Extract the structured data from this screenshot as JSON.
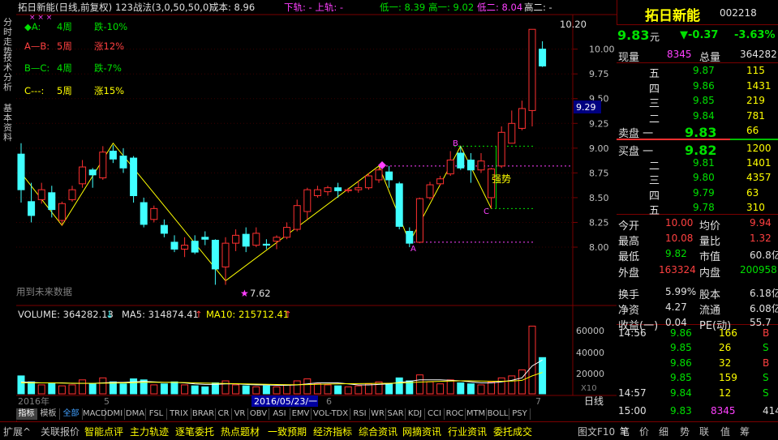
{
  "chart_header": {
    "title": "拓日新能(日线,前复权)",
    "strategy": "123战法(3,0,50,50,0)",
    "cost_label": "成本: 8.96",
    "rail_label": "下轨: - 上轨: -",
    "low1": "低一: 8.39",
    "high1": "高一: 9.02",
    "low2": "低二: 8.04",
    "high2": "高二: -"
  },
  "legend": [
    {
      "label": "◆A:",
      "weeks": "4周",
      "change": "跌-10%"
    },
    {
      "label": "A—B:",
      "weeks": "5周",
      "change": "涨12%"
    },
    {
      "label": "B—C:",
      "weeks": "4周",
      "change": "跌-7%"
    },
    {
      "label": "C---:",
      "weeks": "5周",
      "change": "涨15%"
    }
  ],
  "annotations": {
    "high_value": "10.20",
    "low_value": "7.62",
    "strong": "强势",
    "future_note": "用到未来数据",
    "point_b": "B",
    "point_c": "C",
    "point_a": "A"
  },
  "price_axis": [
    "10.00",
    "9.75",
    "9.50",
    "9.25",
    "9.00",
    "8.75",
    "8.50",
    "8.25",
    "8.00"
  ],
  "price_marker": "9.29",
  "volume_header": {
    "volume": "VOLUME: 364282.13",
    "ma5": "MA5: 314874.41",
    "ma10": "MA10: 215712.41"
  },
  "volume_axis": [
    "60000",
    "40000",
    "20000",
    "X10"
  ],
  "date_axis": {
    "year": "2016年",
    "m5": "5",
    "m6": "6",
    "m7": "7",
    "cursor": "2016/05/23/一",
    "period": "日线"
  },
  "left_tabs": [
    "分时走势",
    "技术分析",
    "基本资料"
  ],
  "indicator_tabs": [
    "指标",
    "模板",
    "全部",
    "MACD",
    "DMI",
    "DMA",
    "FSL",
    "TRIX",
    "BRAR",
    "CR",
    "VR",
    "OBV",
    "ASI",
    "EMV",
    "VOL-TDX",
    "RSI",
    "WR",
    "SAR",
    "KDJ",
    "CCI",
    "ROC",
    "MTM",
    "BOLL",
    "PSY"
  ],
  "bottom_tabs": [
    "扩展^",
    "关联报价",
    "智能点评",
    "主力轨迹",
    "逐笔委托",
    "热点题材",
    "一致预期",
    "经济指标",
    "综合资讯",
    "网摘资讯",
    "行业资讯",
    "委托成交",
    "图文F10"
  ],
  "quote": {
    "name": "拓日新能",
    "code": "002218",
    "price": "9.83",
    "unit": "元",
    "change": "▼-0.37",
    "change_pct": "-3.63%",
    "now_vol_label": "现量",
    "now_vol": "8345",
    "total_vol_label": "总量",
    "total_vol": "364282",
    "sell": [
      {
        "label": "五",
        "price": "9.87",
        "vol": "115"
      },
      {
        "label": "四",
        "price": "9.86",
        "vol": "1431"
      },
      {
        "label": "三",
        "price": "9.85",
        "vol": "219"
      },
      {
        "label": "二",
        "price": "9.84",
        "vol": "781"
      },
      {
        "label": "卖盘 一",
        "price": "9.83",
        "vol": "66"
      }
    ],
    "buy": [
      {
        "label": "买盘 一",
        "price": "9.82",
        "vol": "1200"
      },
      {
        "label": "二",
        "price": "9.81",
        "vol": "1401"
      },
      {
        "label": "三",
        "price": "9.80",
        "vol": "4357"
      },
      {
        "label": "四",
        "price": "9.79",
        "vol": "63"
      },
      {
        "label": "五",
        "price": "9.78",
        "vol": "310"
      }
    ],
    "stats": [
      {
        "l1": "今开",
        "v1": "10.00",
        "l2": "均价",
        "v2": "9.94"
      },
      {
        "l1": "最高",
        "v1": "10.08",
        "l2": "量比",
        "v2": "1.32"
      },
      {
        "l1": "最低",
        "v1": "9.82",
        "l2": "市值",
        "v2": "60.8亿"
      },
      {
        "l1": "外盘",
        "v1": "163324",
        "l2": "内盘",
        "v2": "200958"
      },
      {
        "l1": "换手",
        "v1": "5.99%",
        "l2": "股本",
        "v2": "6.18亿"
      },
      {
        "l1": "净资",
        "v1": "4.27",
        "l2": "流通",
        "v2": "6.08亿"
      },
      {
        "l1": "收益(一)",
        "v1": "0.04",
        "l2": "PE(动)",
        "v2": "55.7"
      }
    ],
    "ticks": [
      {
        "time": "14:56",
        "price": "9.86",
        "vol": "166",
        "side": "B"
      },
      {
        "time": "",
        "price": "9.85",
        "vol": "26",
        "side": "S"
      },
      {
        "time": "",
        "price": "9.86",
        "vol": "32",
        "side": "B"
      },
      {
        "time": "",
        "price": "9.85",
        "vol": "159",
        "side": "S"
      },
      {
        "time": "14:57",
        "price": "9.84",
        "vol": "12",
        "side": "S"
      },
      {
        "time": "15:00",
        "price": "9.83",
        "vol": "8345",
        "side": "414"
      }
    ],
    "side_tabs": [
      "笔",
      "价",
      "细",
      "势",
      "联",
      "值",
      "筹"
    ]
  },
  "chart_data": {
    "type": "candlestick",
    "candles": [
      {
        "o": 8.94,
        "c": 8.58,
        "h": 9.05,
        "l": 8.45
      },
      {
        "o": 8.46,
        "c": 8.32,
        "h": 8.65,
        "l": 8.25
      },
      {
        "o": 8.48,
        "c": 8.58,
        "h": 8.65,
        "l": 8.44
      },
      {
        "o": 8.55,
        "c": 8.38,
        "h": 8.62,
        "l": 8.3
      },
      {
        "o": 8.27,
        "c": 8.44,
        "h": 8.46,
        "l": 8.22
      },
      {
        "o": 8.48,
        "c": 8.58,
        "h": 8.62,
        "l": 8.46
      },
      {
        "o": 8.64,
        "c": 8.81,
        "h": 8.88,
        "l": 8.6
      },
      {
        "o": 8.78,
        "c": 8.73,
        "h": 8.8,
        "l": 8.6
      },
      {
        "o": 8.7,
        "c": 8.96,
        "h": 9.02,
        "l": 8.68
      },
      {
        "o": 8.97,
        "c": 8.89,
        "h": 9.03,
        "l": 8.85
      },
      {
        "o": 8.92,
        "c": 8.8,
        "h": 9.0,
        "l": 8.75
      },
      {
        "o": 8.9,
        "c": 8.52,
        "h": 8.92,
        "l": 8.45
      },
      {
        "o": 8.45,
        "c": 8.23,
        "h": 8.5,
        "l": 8.2
      },
      {
        "o": 8.28,
        "c": 8.39,
        "h": 8.42,
        "l": 8.25
      },
      {
        "o": 8.22,
        "c": 8.14,
        "h": 8.28,
        "l": 8.1
      },
      {
        "o": 8.05,
        "c": 7.98,
        "h": 8.12,
        "l": 7.95
      },
      {
        "o": 7.98,
        "c": 8.02,
        "h": 8.1,
        "l": 7.9
      },
      {
        "o": 8.06,
        "c": 7.95,
        "h": 8.12,
        "l": 7.93
      },
      {
        "o": 8.1,
        "c": 8.08,
        "h": 8.16,
        "l": 8.02
      },
      {
        "o": 8.07,
        "c": 7.78,
        "h": 8.08,
        "l": 7.62
      },
      {
        "o": 7.8,
        "c": 8.04,
        "h": 8.1,
        "l": 7.62
      },
      {
        "o": 8.04,
        "c": 8.12,
        "h": 8.18,
        "l": 7.96
      },
      {
        "o": 8.13,
        "c": 8.01,
        "h": 8.2,
        "l": 7.95
      },
      {
        "o": 8.02,
        "c": 8.14,
        "h": 8.2,
        "l": 8.0
      },
      {
        "o": 8.03,
        "c": 8.02,
        "h": 8.08,
        "l": 7.98
      },
      {
        "o": 8.06,
        "c": 8.1,
        "h": 8.12,
        "l": 7.98
      },
      {
        "o": 8.1,
        "c": 8.2,
        "h": 8.25,
        "l": 8.08
      },
      {
        "o": 8.18,
        "c": 8.42,
        "h": 8.48,
        "l": 8.16
      },
      {
        "o": 8.36,
        "c": 8.58,
        "h": 8.6,
        "l": 8.28
      },
      {
        "o": 8.52,
        "c": 8.58,
        "h": 8.62,
        "l": 8.5
      },
      {
        "o": 8.56,
        "c": 8.6,
        "h": 8.62,
        "l": 8.52
      },
      {
        "o": 8.6,
        "c": 8.57,
        "h": 8.65,
        "l": 8.5
      },
      {
        "o": 8.57,
        "c": 8.58,
        "h": 8.6,
        "l": 8.55
      },
      {
        "o": 8.58,
        "c": 8.6,
        "h": 8.67,
        "l": 8.55
      },
      {
        "o": 8.6,
        "c": 8.72,
        "h": 8.75,
        "l": 8.58
      },
      {
        "o": 8.68,
        "c": 8.78,
        "h": 8.8,
        "l": 8.65
      },
      {
        "o": 8.76,
        "c": 8.68,
        "h": 8.82,
        "l": 8.6
      },
      {
        "o": 8.64,
        "c": 8.21,
        "h": 8.66,
        "l": 8.18
      },
      {
        "o": 8.16,
        "c": 8.04,
        "h": 8.2,
        "l": 8.0
      },
      {
        "o": 8.05,
        "c": 8.49,
        "h": 8.5,
        "l": 8.04
      },
      {
        "o": 8.5,
        "c": 8.63,
        "h": 8.66,
        "l": 8.48
      },
      {
        "o": 8.64,
        "c": 8.69,
        "h": 8.72,
        "l": 8.62
      },
      {
        "o": 8.74,
        "c": 8.88,
        "h": 8.97,
        "l": 8.72
      },
      {
        "o": 8.95,
        "c": 8.8,
        "h": 9.02,
        "l": 8.78
      },
      {
        "o": 8.88,
        "c": 8.78,
        "h": 8.95,
        "l": 8.65
      },
      {
        "o": 8.78,
        "c": 8.87,
        "h": 8.95,
        "l": 8.75
      },
      {
        "o": 8.5,
        "c": 8.79,
        "h": 8.8,
        "l": 8.39
      },
      {
        "o": 8.82,
        "c": 9.16,
        "h": 9.22,
        "l": 8.8
      },
      {
        "o": 9.05,
        "c": 9.25,
        "h": 9.38,
        "l": 9.05
      },
      {
        "o": 9.2,
        "c": 9.4,
        "h": 9.48,
        "l": 9.18
      },
      {
        "o": 9.38,
        "c": 10.2,
        "h": 10.2,
        "l": 9.22
      },
      {
        "o": 10.0,
        "c": 9.83,
        "h": 10.08,
        "l": 9.82
      }
    ],
    "volumes": [
      18000,
      12000,
      9000,
      11000,
      8000,
      9000,
      14000,
      10000,
      16000,
      12000,
      10000,
      15000,
      14000,
      9000,
      10000,
      12000,
      9000,
      8000,
      7000,
      11000,
      13000,
      9000,
      8000,
      7000,
      8000,
      7000,
      9000,
      13000,
      15000,
      10000,
      9000,
      8000,
      7000,
      8000,
      10000,
      12000,
      10000,
      16000,
      13000,
      19000,
      12000,
      10000,
      14000,
      11000,
      10000,
      9000,
      12000,
      16000,
      18000,
      24000,
      68000,
      36400
    ],
    "ma5_line": [
      12000,
      11500,
      11000,
      11000,
      11000,
      10500,
      10500,
      10500,
      11000,
      11500,
      11500,
      12000,
      12500,
      12000,
      11500,
      11500,
      11000,
      10000,
      9500,
      9500,
      10000,
      10000,
      9500,
      9000,
      9000,
      8500,
      8500,
      9000,
      10000,
      11000,
      11000,
      11000,
      10000,
      9000,
      9000,
      9500,
      10000,
      11500,
      12500,
      14000,
      14000,
      14000,
      13500,
      13000,
      12000,
      11000,
      11000,
      12000,
      13500,
      16000,
      28000,
      34000
    ],
    "ma10_line": [
      11000,
      11000,
      11000,
      11000,
      10800,
      10700,
      10600,
      10600,
      10700,
      10800,
      11000,
      11200,
      11500,
      11600,
      11500,
      11500,
      11300,
      11000,
      10800,
      10600,
      10400,
      10200,
      10000,
      9800,
      9600,
      9400,
      9200,
      9200,
      9300,
      9600,
      9800,
      10000,
      10200,
      10300,
      10400,
      10500,
      10600,
      10900,
      11200,
      11800,
      12200,
      12500,
      12800,
      13000,
      13000,
      12800,
      12600,
      12600,
      12800,
      13500,
      18000,
      21500
    ],
    "zigzag_idx": [
      0,
      4,
      9,
      20,
      35,
      38,
      43,
      46
    ],
    "zigzag_price": [
      8.75,
      8.22,
      9.05,
      7.66,
      8.82,
      8.05,
      9.02,
      8.39
    ],
    "ylim": [
      7.55,
      10.3
    ]
  }
}
